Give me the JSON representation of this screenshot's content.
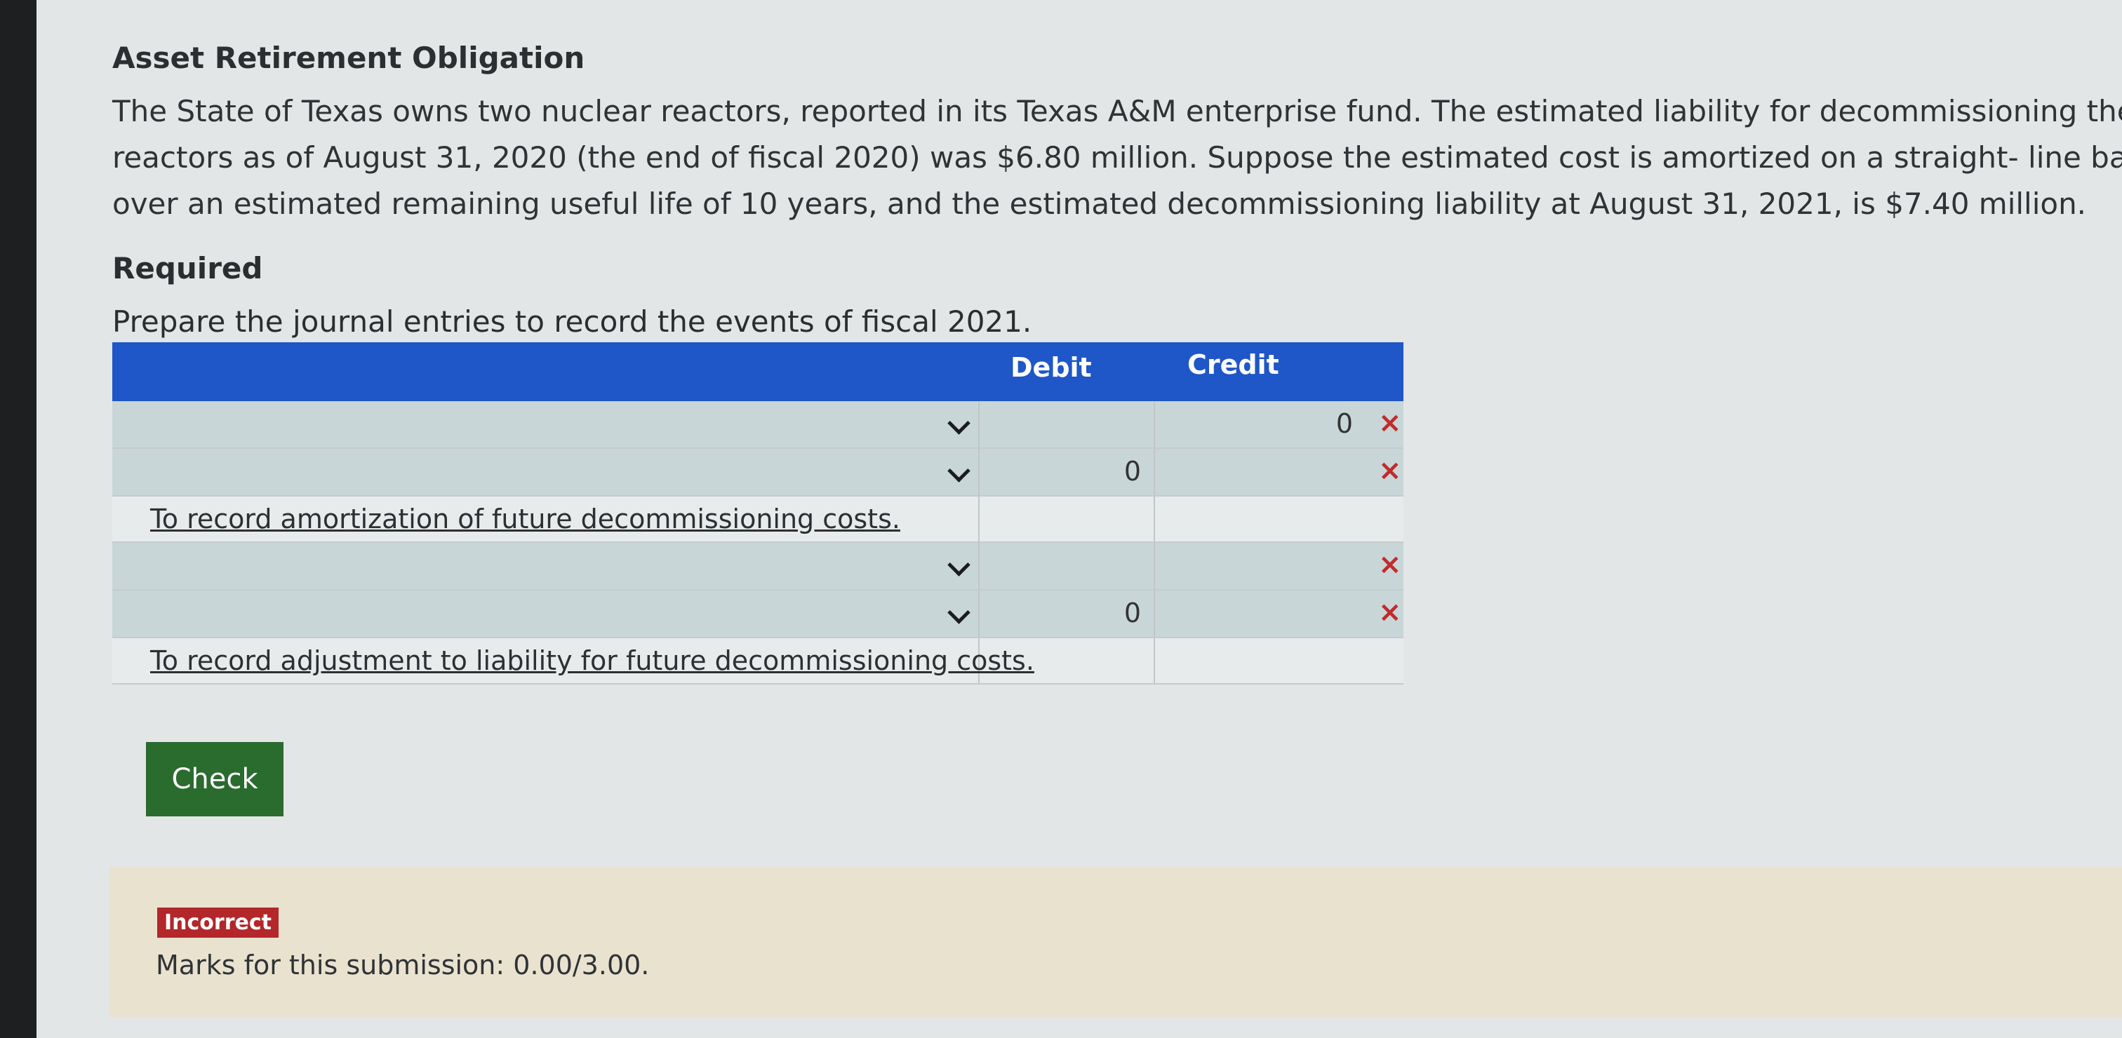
{
  "heading": "Asset Retirement Obligation",
  "problem_lines": [
    "The State of Texas owns two nuclear reactors, reported in its Texas A&M enterprise fund. The estimated liability for decommissioning the",
    "reactors as of August 31, 2020 (the end of fiscal 2020) was $6.80 million. Suppose the estimated cost is amortized on a straight- line basis",
    "over an estimated remaining useful life of 10 years, and the estimated decommissioning liability at August 31, 2021, is $7.40 million."
  ],
  "required_label": "Required",
  "instruction": "Prepare the journal entries to record the events of fiscal 2021.",
  "journal": {
    "headers": {
      "debit": "Debit",
      "credit": "Credit"
    },
    "rows": [
      {
        "debit": "",
        "credit": "0",
        "mark": "×"
      },
      {
        "debit": "0",
        "credit": "",
        "mark": "×"
      },
      {
        "memo": "To record amortization of future decommissioning costs."
      },
      {
        "debit": "",
        "credit": "",
        "mark": "×"
      },
      {
        "debit": "0",
        "credit": "",
        "mark": "×"
      },
      {
        "memo": "To record adjustment to liability for future decommissioning costs."
      }
    ]
  },
  "check_label": "Check",
  "feedback": {
    "status": "Incorrect",
    "marks": "Marks for this submission: 0.00/3.00."
  },
  "colors": {
    "header_blue": "#1f56c8",
    "check_green": "#2a6b2e",
    "incorrect_red": "#b3262a",
    "feedback_bg": "#e9e2cf"
  }
}
